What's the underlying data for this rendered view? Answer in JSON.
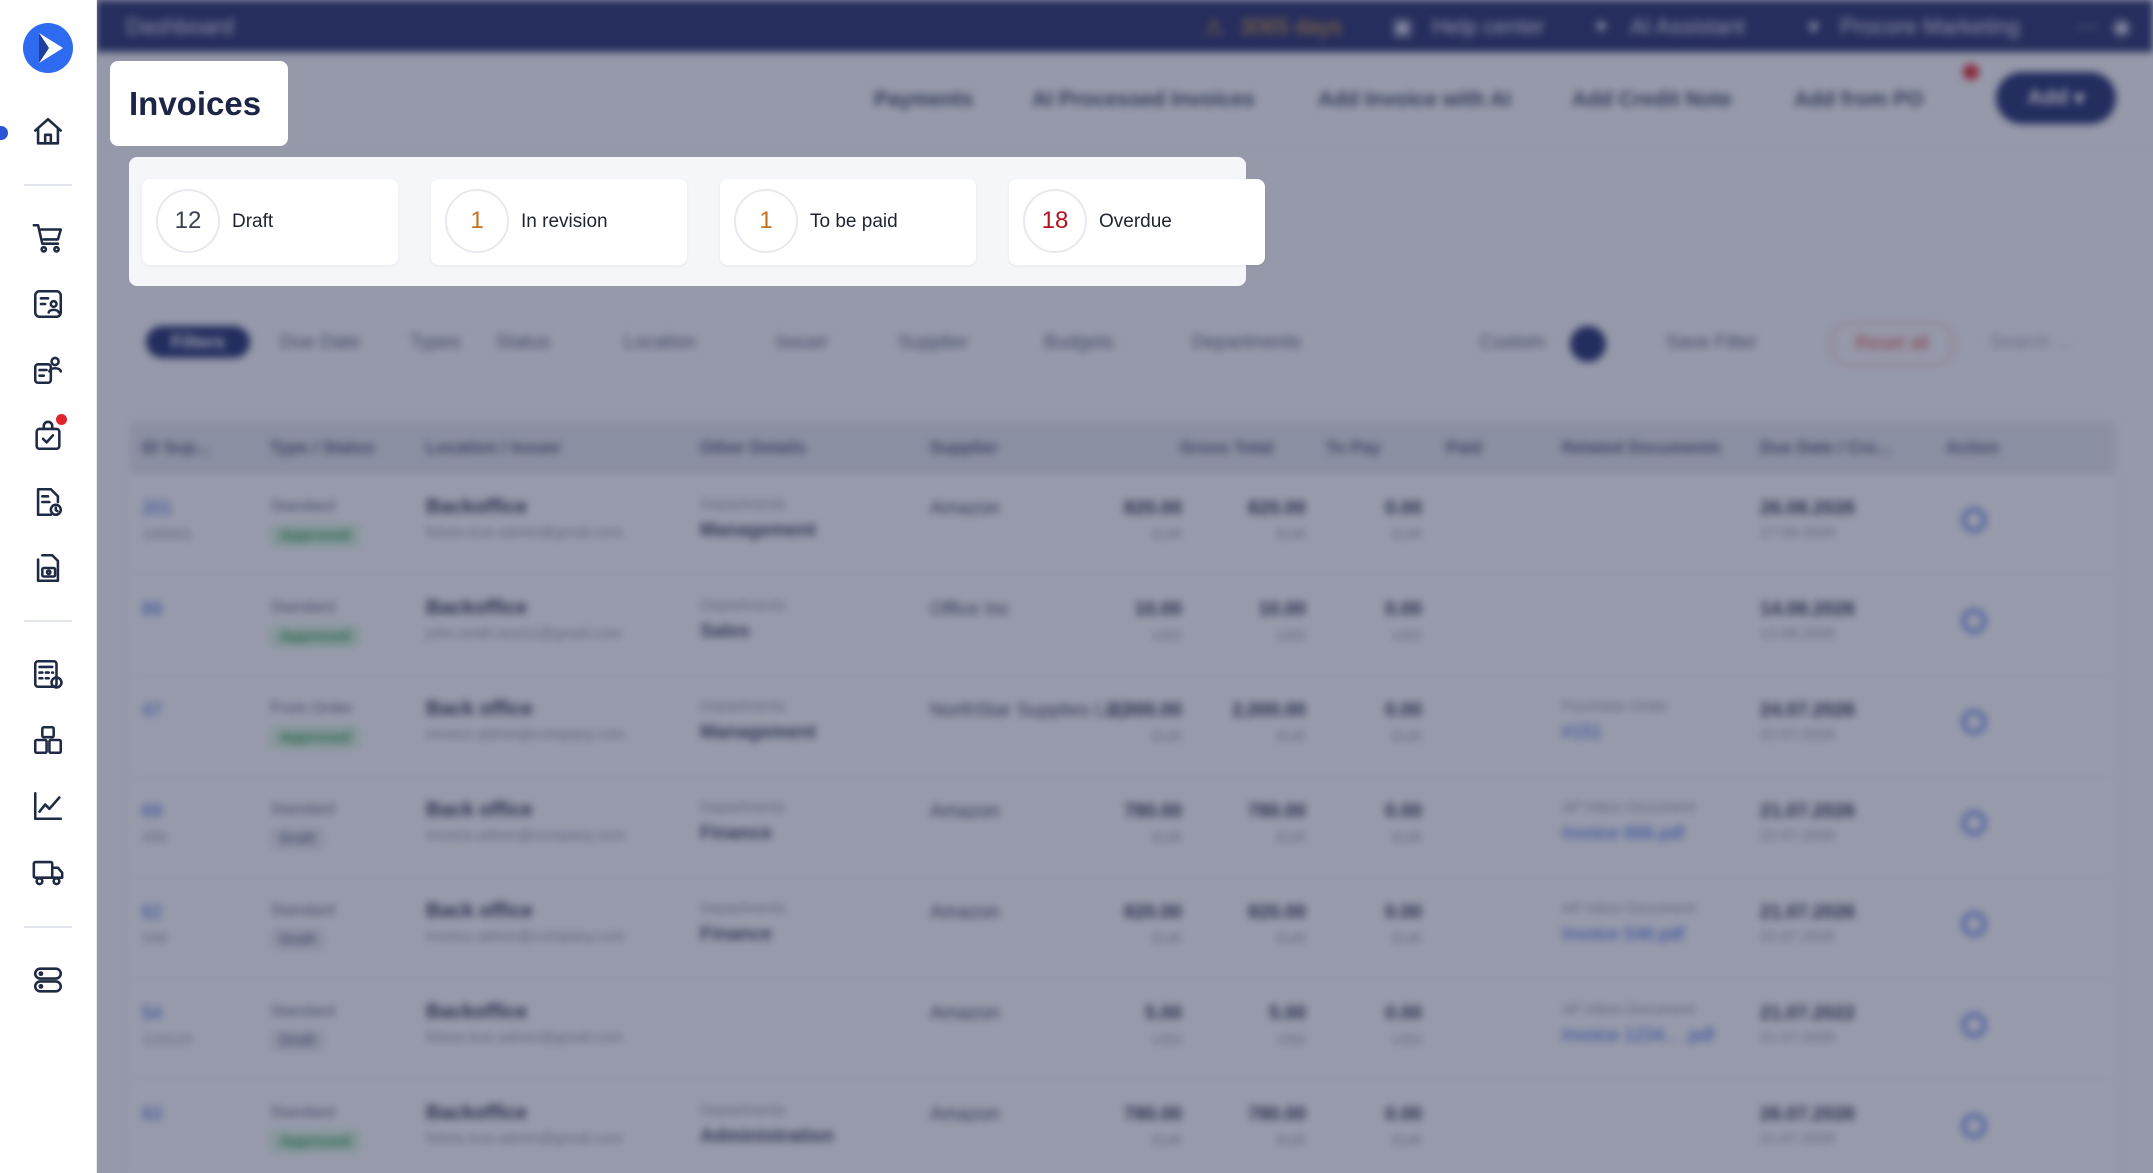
{
  "app": {
    "title": "Invoices"
  },
  "topbar": {
    "breadcrumb": "Dashboard",
    "trial_notice": "3065 days",
    "help": "Help center",
    "ai": "AI Assistant",
    "company": "Procore Marketing"
  },
  "actions": {
    "payments": "Payments",
    "ai_processed": "AI Processed Invoices",
    "add_ai": "Add Invoice with AI",
    "add_credit": "Add Credit Note",
    "add_po": "Add from PO",
    "add": "Add"
  },
  "status_summary": [
    {
      "count": "12",
      "label": "Draft",
      "color": "#3a3f4d"
    },
    {
      "count": "1",
      "label": "In revision",
      "color": "#c2711a"
    },
    {
      "count": "1",
      "label": "To be paid",
      "color": "#c2711a"
    },
    {
      "count": "18",
      "label": "Overdue",
      "color": "#b3131d"
    }
  ],
  "filters": {
    "filters_button": "Filters",
    "items": [
      "Due Date",
      "Types",
      "Status",
      "Location",
      "Issuer",
      "Supplier",
      "Budgets",
      "Departments",
      "Custom"
    ],
    "save": "Save Filter",
    "reset": "Reset all",
    "search_placeholder": "Search ..."
  },
  "table": {
    "headers": [
      "ID Sup...",
      "Type / Status",
      "Location / Issuer",
      "Other Details",
      "Supplier",
      "Gross Total",
      "To Pay",
      "Paid",
      "Related Documents",
      "Due Date / Cre...",
      "Action"
    ],
    "rows": [
      {
        "id": "201",
        "sub": "100001",
        "type": "Standard",
        "status": "Approved",
        "loc": "Backoffice",
        "mail": "fetree.true.admin@gmail.com",
        "dlab": "Departments",
        "dval": "Management",
        "supplier": "Amazon",
        "gross": "820.00",
        "topay": "820.00",
        "paid": "0.00",
        "cur": "EUR",
        "rlab": "",
        "rval": "",
        "due": "26.08.2026",
        "created": "17.06.2026"
      },
      {
        "id": "89",
        "sub": "",
        "type": "Standard",
        "status": "Approved",
        "loc": "Backoffice",
        "mail": "john.smith.test11@gmail.com",
        "dlab": "Departments",
        "dval": "Sales",
        "supplier": "Office Inc",
        "gross": "10.00",
        "topay": "10.00",
        "paid": "0.00",
        "cur": "USD",
        "rlab": "",
        "rval": "",
        "due": "14.08.2026",
        "created": "13.08.2026"
      },
      {
        "id": "47",
        "sub": "",
        "type": "From Order",
        "status": "Approved",
        "loc": "Back office",
        "mail": "invoice.admin@company.com",
        "dlab": "Departments",
        "dval": "Management",
        "supplier": "NorthStar Supplies LLC",
        "gross": "2,000.00",
        "topay": "2,000.00",
        "paid": "0.00",
        "cur": "EUR",
        "rlab": "Purchase Order",
        "rval": "#151",
        "due": "24.07.2026",
        "created": "22.07.2026"
      },
      {
        "id": "69",
        "sub": "456",
        "type": "Standard",
        "status": "Draft",
        "loc": "Back office",
        "mail": "invoice.admin@company.com",
        "dlab": "Departments",
        "dval": "Finance",
        "supplier": "Amazon",
        "gross": "780.00",
        "topay": "780.00",
        "paid": "0.00",
        "cur": "EUR",
        "rlab": "AP Inbox Document",
        "rval": "Invoice 666.pdf",
        "due": "21.07.2026",
        "created": "22.07.2026"
      },
      {
        "id": "62",
        "sub": "546",
        "type": "Standard",
        "status": "Draft",
        "loc": "Back office",
        "mail": "invoice.admin@company.com",
        "dlab": "Departments",
        "dval": "Finance",
        "supplier": "Amazon",
        "gross": "820.00",
        "topay": "820.00",
        "paid": "0.00",
        "cur": "EUR",
        "rlab": "AP Inbox Document",
        "rval": "Invoice 546.pdf",
        "due": "21.07.2026",
        "created": "22.07.2026"
      },
      {
        "id": "54",
        "sub": "123123",
        "type": "Standard",
        "status": "Draft",
        "loc": "Backoffice",
        "mail": "fetree.true.admin@gmail.com",
        "dlab": "",
        "dval": "",
        "supplier": "Amazon",
        "gross": "5.00",
        "topay": "5.00",
        "paid": "0.00",
        "cur": "USD",
        "rlab": "AP Inbox Document",
        "rval": "Invoice 1234... .pdf",
        "due": "21.07.2022",
        "created": "21.07.2026"
      },
      {
        "id": "63",
        "sub": "",
        "type": "Standard",
        "status": "Approved",
        "loc": "Backoffice",
        "mail": "fetree.true.admin@gmail.com",
        "dlab": "Departments",
        "dval": "Administration",
        "supplier": "Amazon",
        "gross": "780.00",
        "topay": "780.00",
        "paid": "0.00",
        "cur": "EUR",
        "rlab": "",
        "rval": "",
        "due": "26.07.2026",
        "created": "21.07.2026"
      }
    ]
  }
}
